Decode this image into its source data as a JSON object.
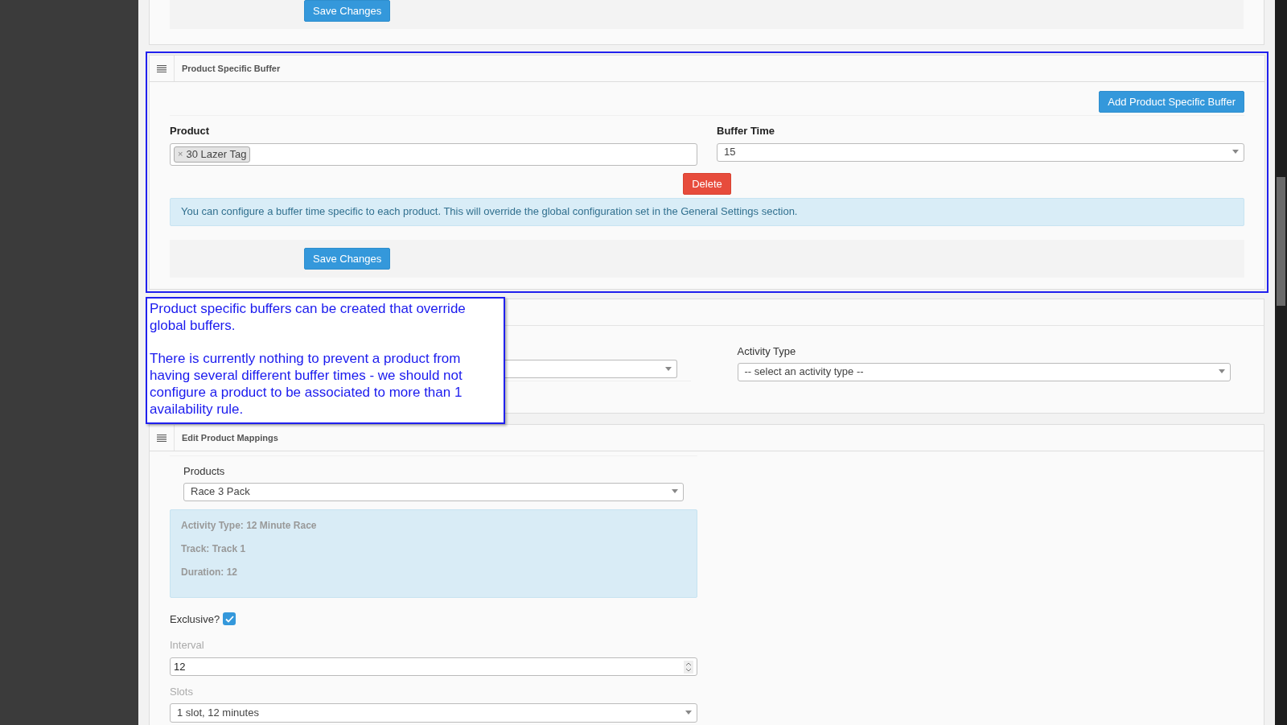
{
  "top_panel": {
    "save_button": "Save Changes"
  },
  "buffer_panel": {
    "title": "Product Specific Buffer",
    "highlighted": true,
    "add_button": "Add Product Specific Buffer",
    "product_label": "Product",
    "product_tags": [
      {
        "remove": "×",
        "label": "30 Lazer Tag"
      }
    ],
    "buffer_time_label": "Buffer Time",
    "buffer_time_value": "15",
    "delete_button": "Delete",
    "info": "You can configure a buffer time specific to each product. This will override the global configuration set in the General Settings section.",
    "save_button": "Save Changes"
  },
  "annotation": {
    "paragraphs": [
      "Product specific buffers can be created that override global buffers.",
      "There is currently nothing to prevent a product from having several different buffer times - we should not configure a product to be associated to more than 1 availability rule."
    ]
  },
  "rule_panel": {
    "activity_type_label": "Activity Type",
    "activity_type_value": "-- select an activity type --"
  },
  "mappings_panel": {
    "title": "Edit Product Mappings",
    "products_label": "Products",
    "products_value": "Race 3 Pack",
    "details": [
      "Activity Type: 12 Minute Race",
      "Track: Track 1",
      "Duration: 12"
    ],
    "exclusive_label": "Exclusive?",
    "exclusive_checked": true,
    "interval_label": "Interval",
    "interval_value": "12",
    "slots_label": "Slots",
    "slots_value": "1 slot, 12 minutes"
  }
}
